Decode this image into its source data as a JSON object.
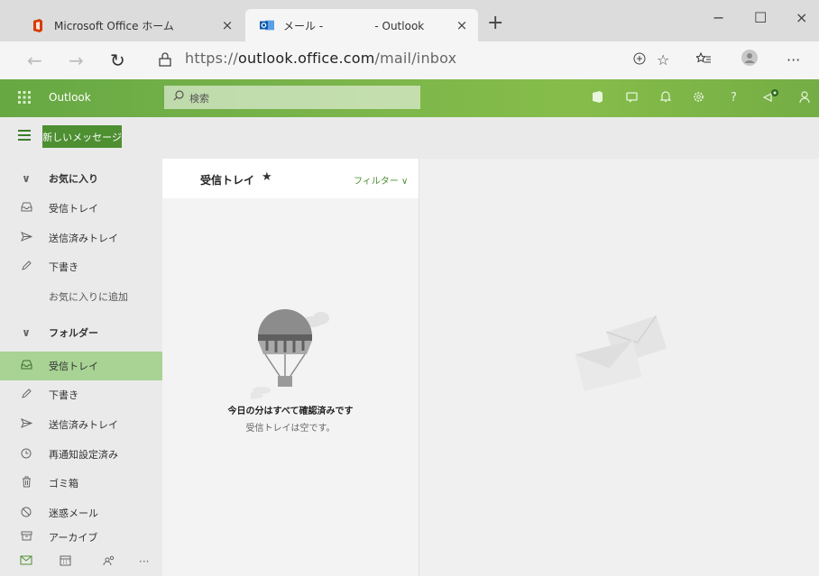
{
  "browser": {
    "tabs": [
      {
        "title": "Microsoft Office ホーム",
        "close": "×",
        "active": false
      },
      {
        "title": "メール -               - Outlook",
        "close": "×",
        "active": true
      }
    ],
    "new_tab": "+",
    "window_controls": {
      "minimize": "−",
      "maximize": "☐",
      "close": "×"
    },
    "nav": {
      "back": "←",
      "forward": "→",
      "refresh": "↻"
    },
    "url": {
      "prefix": "https://",
      "host": "outlook.office.com",
      "path": "/mail/inbox"
    },
    "toolbar_icons": [
      "add-favorite-icon",
      "star-icon",
      "favorites-icon",
      "profile-icon",
      "more-icon"
    ],
    "more": "···"
  },
  "owa": {
    "brand": "Outlook",
    "search_placeholder": "検索",
    "header_icons": [
      "office-icon",
      "skype-icon",
      "bell-icon",
      "gear-icon",
      "help-icon",
      "megaphone-icon",
      "person-icon"
    ],
    "help": "?",
    "new_message": "新しいメッセージ"
  },
  "nav": {
    "favorites_header": "お気に入り",
    "favorites": [
      {
        "label": "受信トレイ",
        "icon": "inbox-icon"
      },
      {
        "label": "送信済みトレイ",
        "icon": "send-icon"
      },
      {
        "label": "下書き",
        "icon": "pencil-icon"
      }
    ],
    "add_favorite": "お気に入りに追加",
    "folders_header": "フォルダー",
    "folders": [
      {
        "label": "受信トレイ",
        "icon": "inbox-icon",
        "selected": true
      },
      {
        "label": "下書き",
        "icon": "pencil-icon"
      },
      {
        "label": "送信済みトレイ",
        "icon": "send-icon"
      },
      {
        "label": "再通知設定済み",
        "icon": "clock-icon"
      },
      {
        "label": "ゴミ箱",
        "icon": "trash-icon"
      },
      {
        "label": "迷惑メール",
        "icon": "block-icon"
      },
      {
        "label": "アーカイブ",
        "icon": "archive-icon"
      }
    ],
    "footer_icons": [
      "mail-icon",
      "calendar-icon",
      "people-icon",
      "more-icon"
    ],
    "footer_more": "···"
  },
  "list": {
    "title": "受信トレイ",
    "star": "★",
    "filter": "フィルター",
    "empty_title": "今日の分はすべて確認済みです",
    "empty_subtitle": "受信トレイは空です。"
  },
  "colors": {
    "accent": "#4d8f31",
    "header_green": "#7ab44b",
    "selected_bg": "#a8d394"
  }
}
